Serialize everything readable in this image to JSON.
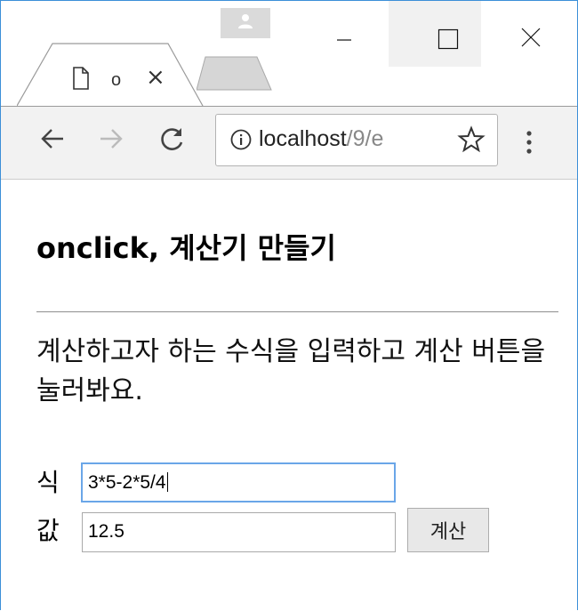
{
  "browser": {
    "tab": {
      "title": "o",
      "close_glyph": "×"
    },
    "address": {
      "host": "localhost",
      "path": "/9/e"
    },
    "icons": [
      "page-icon",
      "back-icon",
      "forward-icon",
      "reload-icon",
      "info-icon",
      "star-icon",
      "menu-icon",
      "profile-icon",
      "minimize-icon",
      "maximize-icon",
      "close-icon"
    ]
  },
  "page": {
    "heading": "onclick, 계산기 만들기",
    "description": "계산하고자 하는 수식을 입력하고 계산 버튼을 눌러봐요.",
    "form": {
      "expr_label": "식",
      "expr_value": "3*5-2*5/4",
      "value_label": "값",
      "value_value": "12.5",
      "calc_button": "계산"
    }
  },
  "colors": {
    "window_border": "#3c8fd8",
    "focus_border": "#6aa6e8",
    "toolbar_bg": "#f2f2f2"
  }
}
